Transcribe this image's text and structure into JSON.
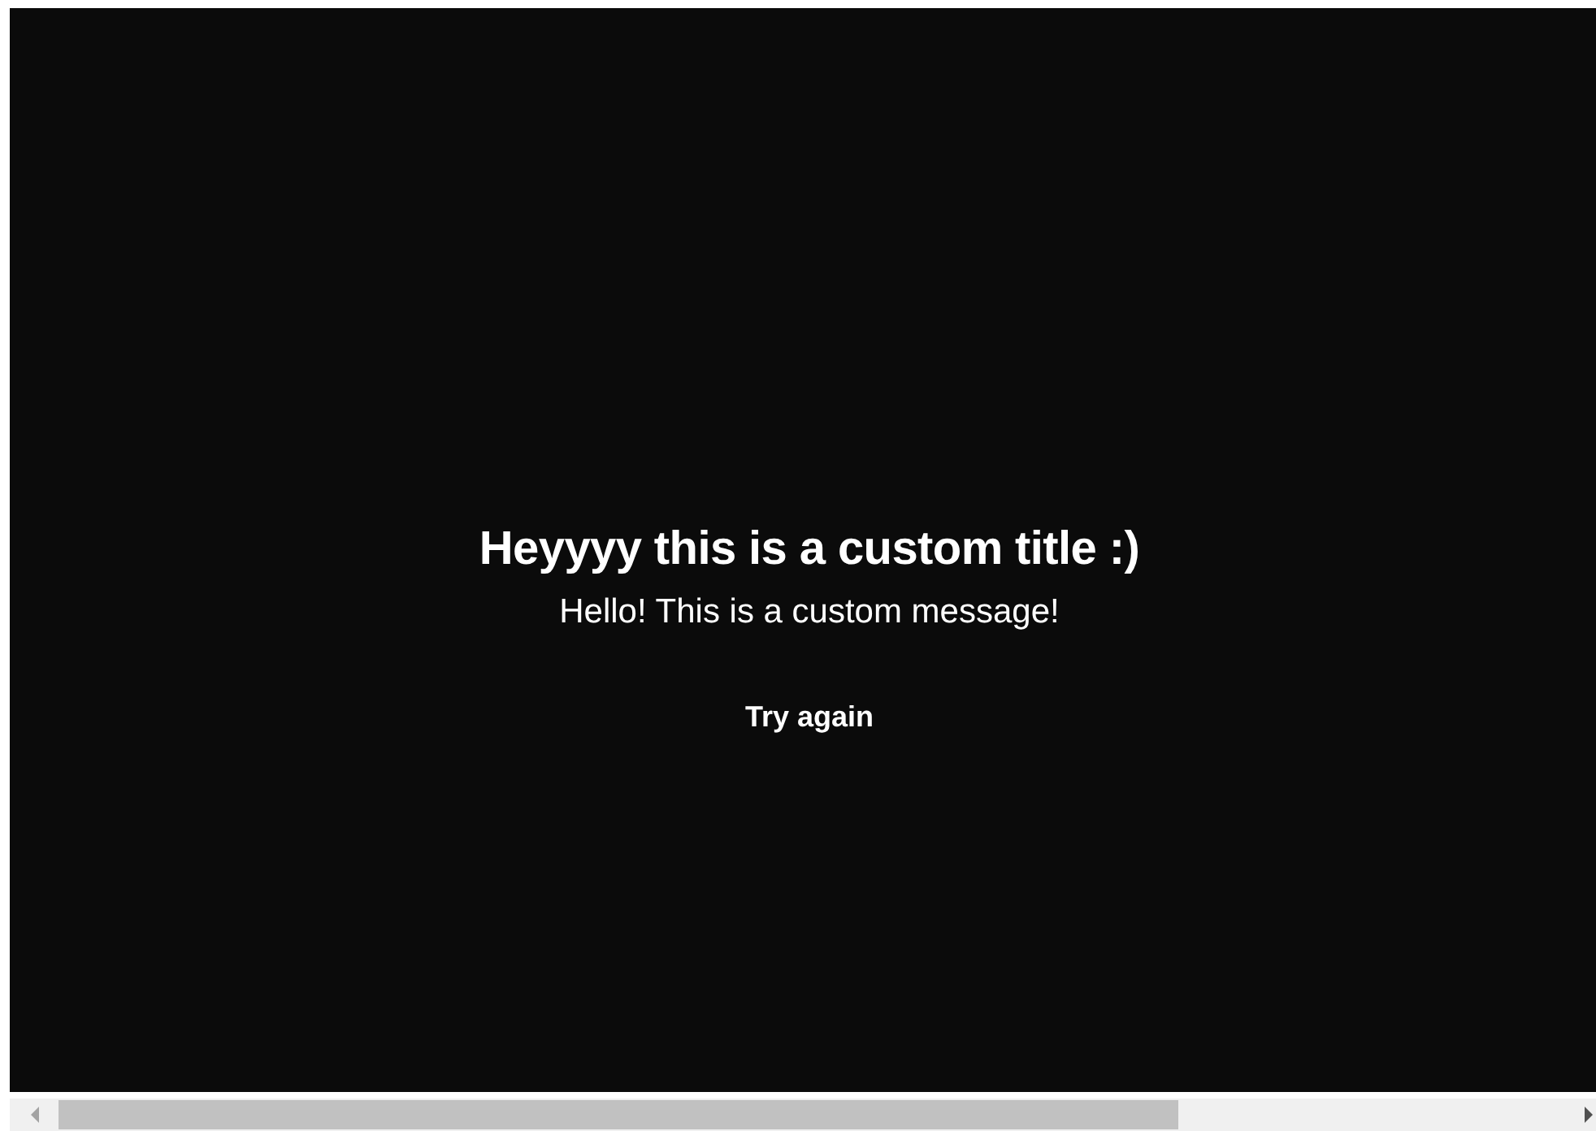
{
  "error_screen": {
    "title": "Heyyyy this is a custom title :)",
    "message": "Hello! This is a custom message!",
    "retry_button": "Try again"
  }
}
